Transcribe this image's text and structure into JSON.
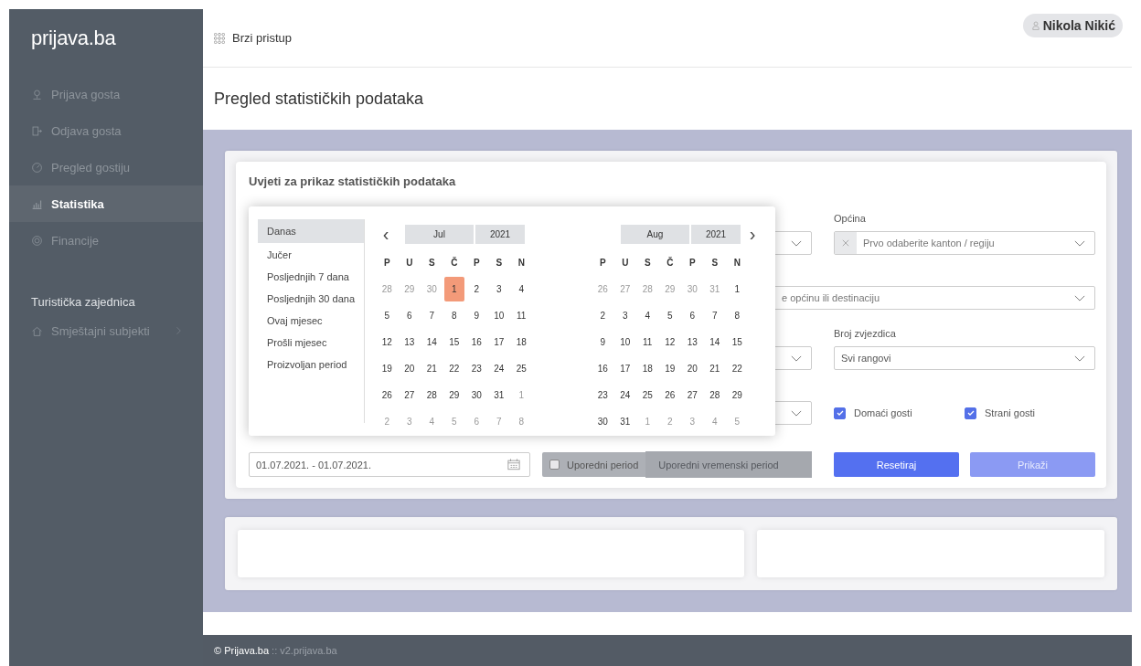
{
  "logo": "prijava.ba",
  "sidebar": {
    "items": [
      {
        "label": "Prijava gosta",
        "kind": "pin",
        "selected": false
      },
      {
        "label": "Odjava gosta",
        "kind": "door",
        "selected": false
      },
      {
        "label": "Pregled gostiju",
        "kind": "gauge",
        "selected": false
      },
      {
        "label": "Statistika",
        "kind": "chart",
        "selected": true
      },
      {
        "label": "Financije",
        "kind": "coins",
        "selected": false
      }
    ],
    "section": "Turistička zajednica",
    "section_items": [
      {
        "label": "Smještajni subjekti",
        "kind": "home",
        "selected": false
      }
    ]
  },
  "topbar": {
    "quick_access": "Brzi pristup",
    "user": "Nikola Nikić"
  },
  "page_title": "Pregled statističkih podataka",
  "filters": {
    "title": "Uvjeti za prikaz statističkih podataka",
    "municipality": {
      "label": "Općina",
      "placeholder": "Prvo odaberite kanton / regiju"
    },
    "destination": {
      "placeholder": "e općinu ili destinaciju"
    },
    "stars": {
      "label": "Broj zvjezdica",
      "value": "Svi rangovi"
    },
    "guests": [
      {
        "label": "Domaći gosti",
        "checked": true
      },
      {
        "label": "Strani gosti",
        "checked": true
      }
    ],
    "date_range": "01.07.2021. - 01.07.2021.",
    "compare": {
      "label": "Uporedni period",
      "checked": false,
      "placeholder": "Uporedni vremenski period"
    },
    "buttons": [
      {
        "label": "Resetiraj",
        "disabled": false
      },
      {
        "label": "Prikaži",
        "disabled": true
      }
    ]
  },
  "datepicker": {
    "presets": [
      {
        "label": "Danas",
        "selected": true
      },
      {
        "label": "Jučer",
        "selected": false
      },
      {
        "label": "Posljednjih 7 dana",
        "selected": false
      },
      {
        "label": "Posljednjih 30 dana",
        "selected": false
      },
      {
        "label": "Ovaj mjesec",
        "selected": false
      },
      {
        "label": "Prošli mjesec",
        "selected": false
      },
      {
        "label": "Proizvoljan period",
        "selected": false
      }
    ],
    "prev": "‹",
    "next": "›",
    "months": [
      {
        "month": "Jul",
        "year": "2021",
        "weekdays": [
          "P",
          "U",
          "S",
          "Č",
          "P",
          "S",
          "N"
        ],
        "weeks": [
          [
            {
              "day": "28",
              "outside": true,
              "selected": false
            },
            {
              "day": "29",
              "outside": true,
              "selected": false
            },
            {
              "day": "30",
              "outside": true,
              "selected": false
            },
            {
              "day": "1",
              "outside": false,
              "selected": true
            },
            {
              "day": "2",
              "outside": false,
              "selected": false
            },
            {
              "day": "3",
              "outside": false,
              "selected": false
            },
            {
              "day": "4",
              "outside": false,
              "selected": false
            }
          ],
          [
            {
              "day": "5",
              "outside": false,
              "selected": false
            },
            {
              "day": "6",
              "outside": false,
              "selected": false
            },
            {
              "day": "7",
              "outside": false,
              "selected": false
            },
            {
              "day": "8",
              "outside": false,
              "selected": false
            },
            {
              "day": "9",
              "outside": false,
              "selected": false
            },
            {
              "day": "10",
              "outside": false,
              "selected": false
            },
            {
              "day": "11",
              "outside": false,
              "selected": false
            }
          ],
          [
            {
              "day": "12",
              "outside": false,
              "selected": false
            },
            {
              "day": "13",
              "outside": false,
              "selected": false
            },
            {
              "day": "14",
              "outside": false,
              "selected": false
            },
            {
              "day": "15",
              "outside": false,
              "selected": false
            },
            {
              "day": "16",
              "outside": false,
              "selected": false
            },
            {
              "day": "17",
              "outside": false,
              "selected": false
            },
            {
              "day": "18",
              "outside": false,
              "selected": false
            }
          ],
          [
            {
              "day": "19",
              "outside": false,
              "selected": false
            },
            {
              "day": "20",
              "outside": false,
              "selected": false
            },
            {
              "day": "21",
              "outside": false,
              "selected": false
            },
            {
              "day": "22",
              "outside": false,
              "selected": false
            },
            {
              "day": "23",
              "outside": false,
              "selected": false
            },
            {
              "day": "24",
              "outside": false,
              "selected": false
            },
            {
              "day": "25",
              "outside": false,
              "selected": false
            }
          ],
          [
            {
              "day": "26",
              "outside": false,
              "selected": false
            },
            {
              "day": "27",
              "outside": false,
              "selected": false
            },
            {
              "day": "28",
              "outside": false,
              "selected": false
            },
            {
              "day": "29",
              "outside": false,
              "selected": false
            },
            {
              "day": "30",
              "outside": false,
              "selected": false
            },
            {
              "day": "31",
              "outside": false,
              "selected": false
            },
            {
              "day": "1",
              "outside": true,
              "selected": false
            }
          ],
          [
            {
              "day": "2",
              "outside": true,
              "selected": false
            },
            {
              "day": "3",
              "outside": true,
              "selected": false
            },
            {
              "day": "4",
              "outside": true,
              "selected": false
            },
            {
              "day": "5",
              "outside": true,
              "selected": false
            },
            {
              "day": "6",
              "outside": true,
              "selected": false
            },
            {
              "day": "7",
              "outside": true,
              "selected": false
            },
            {
              "day": "8",
              "outside": true,
              "selected": false
            }
          ]
        ]
      },
      {
        "month": "Aug",
        "year": "2021",
        "weekdays": [
          "P",
          "U",
          "S",
          "Č",
          "P",
          "S",
          "N"
        ],
        "weeks": [
          [
            {
              "day": "26",
              "outside": true,
              "selected": false
            },
            {
              "day": "27",
              "outside": true,
              "selected": false
            },
            {
              "day": "28",
              "outside": true,
              "selected": false
            },
            {
              "day": "29",
              "outside": true,
              "selected": false
            },
            {
              "day": "30",
              "outside": true,
              "selected": false
            },
            {
              "day": "31",
              "outside": true,
              "selected": false
            },
            {
              "day": "1",
              "outside": false,
              "selected": false
            }
          ],
          [
            {
              "day": "2",
              "outside": false,
              "selected": false
            },
            {
              "day": "3",
              "outside": false,
              "selected": false
            },
            {
              "day": "4",
              "outside": false,
              "selected": false
            },
            {
              "day": "5",
              "outside": false,
              "selected": false
            },
            {
              "day": "6",
              "outside": false,
              "selected": false
            },
            {
              "day": "7",
              "outside": false,
              "selected": false
            },
            {
              "day": "8",
              "outside": false,
              "selected": false
            }
          ],
          [
            {
              "day": "9",
              "outside": false,
              "selected": false
            },
            {
              "day": "10",
              "outside": false,
              "selected": false
            },
            {
              "day": "11",
              "outside": false,
              "selected": false
            },
            {
              "day": "12",
              "outside": false,
              "selected": false
            },
            {
              "day": "13",
              "outside": false,
              "selected": false
            },
            {
              "day": "14",
              "outside": false,
              "selected": false
            },
            {
              "day": "15",
              "outside": false,
              "selected": false
            }
          ],
          [
            {
              "day": "16",
              "outside": false,
              "selected": false
            },
            {
              "day": "17",
              "outside": false,
              "selected": false
            },
            {
              "day": "18",
              "outside": false,
              "selected": false
            },
            {
              "day": "19",
              "outside": false,
              "selected": false
            },
            {
              "day": "20",
              "outside": false,
              "selected": false
            },
            {
              "day": "21",
              "outside": false,
              "selected": false
            },
            {
              "day": "22",
              "outside": false,
              "selected": false
            }
          ],
          [
            {
              "day": "23",
              "outside": false,
              "selected": false
            },
            {
              "day": "24",
              "outside": false,
              "selected": false
            },
            {
              "day": "25",
              "outside": false,
              "selected": false
            },
            {
              "day": "26",
              "outside": false,
              "selected": false
            },
            {
              "day": "27",
              "outside": false,
              "selected": false
            },
            {
              "day": "28",
              "outside": false,
              "selected": false
            },
            {
              "day": "29",
              "outside": false,
              "selected": false
            }
          ],
          [
            {
              "day": "30",
              "outside": false,
              "selected": false
            },
            {
              "day": "31",
              "outside": false,
              "selected": false
            },
            {
              "day": "1",
              "outside": true,
              "selected": false
            },
            {
              "day": "2",
              "outside": true,
              "selected": false
            },
            {
              "day": "3",
              "outside": true,
              "selected": false
            },
            {
              "day": "4",
              "outside": true,
              "selected": false
            },
            {
              "day": "5",
              "outside": true,
              "selected": false
            }
          ]
        ]
      }
    ]
  },
  "footer": {
    "brand": "© Prijava.ba",
    "link": ":: v2.prijava.ba"
  }
}
